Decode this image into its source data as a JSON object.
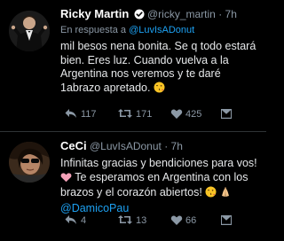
{
  "colors": {
    "background": "#000000",
    "text": "#e6e8ea",
    "muted": "#8b98a5",
    "link": "#1da1f2",
    "verified": "#1da1f2"
  },
  "tweets": [
    {
      "display_name": "Ricky Martin",
      "verified": true,
      "handle": "@ricky_martin",
      "separator": "·",
      "time": "7h",
      "reply_prefix": "En respuesta a ",
      "reply_handle": "@LuvIsADonut",
      "text_main": "mil besos nena bonita. Se q todo estará bien. Eres luz. Cuando vuelva a la Argentina nos veremos y te daré 1abrazo apretado.",
      "text_emoji": "face-blowing-kiss-emoji",
      "actions": {
        "reply_count": "117",
        "retweet_count": "171",
        "like_count": "425",
        "icons": [
          "reply-icon",
          "retweet-icon",
          "heart-icon",
          "direct-message-icon"
        ]
      }
    },
    {
      "display_name": "CeCi",
      "verified": false,
      "handle": "@LuvIsADonut",
      "separator": "·",
      "time": "7h",
      "text_line1": "Infinitas gracias y bendiciones para vos!",
      "text_line2": " Te esperamos en Argentina con los brazos y el corazón abiertos! ",
      "text_emojis": [
        "heart-emoji",
        "face-blowing-kiss-emoji",
        "folded-hands-emoji"
      ],
      "mention": "@DamicoPau",
      "actions": {
        "reply_count": "4",
        "retweet_count": "13",
        "like_count": "66",
        "icons": [
          "reply-icon",
          "retweet-icon",
          "heart-icon",
          "direct-message-icon"
        ]
      }
    }
  ]
}
